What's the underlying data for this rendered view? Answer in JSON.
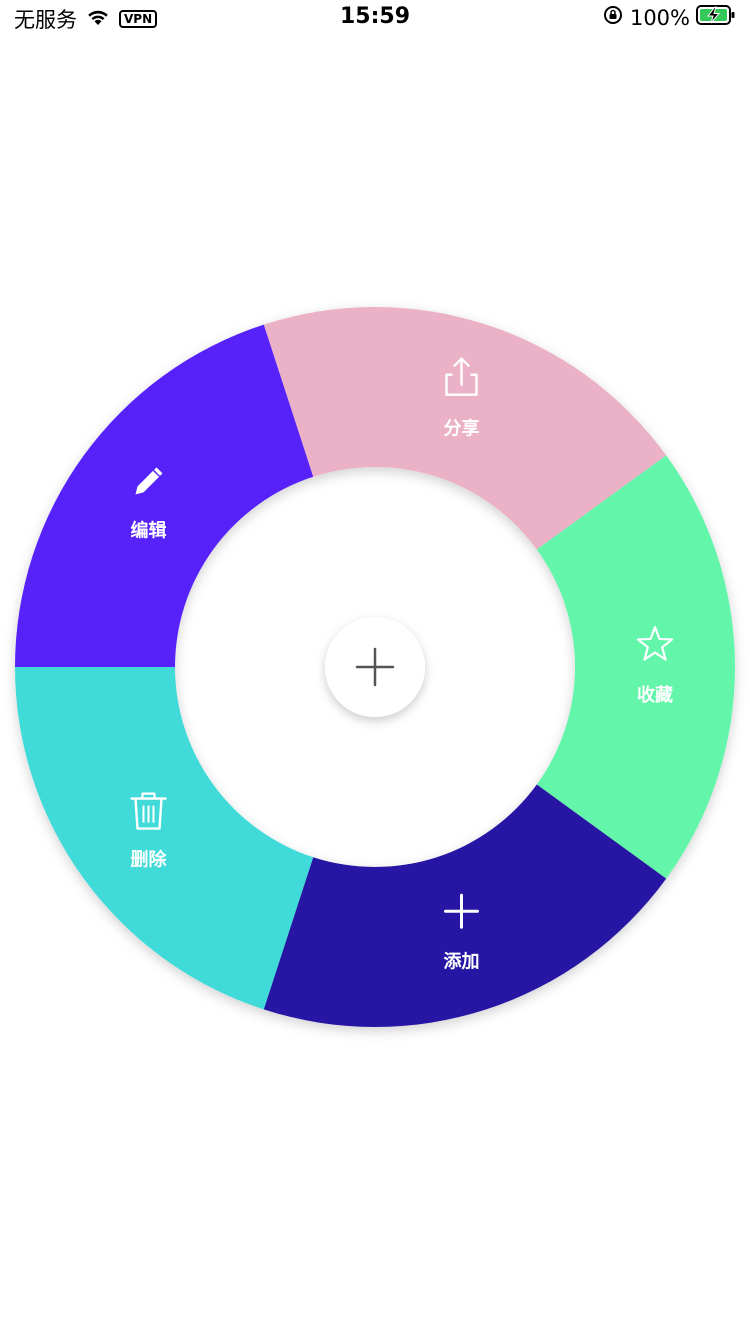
{
  "status_bar": {
    "carrier": "无服务",
    "vpn": "VPN",
    "time": "15:59",
    "battery_percent": "100%"
  },
  "center_button": {
    "icon": "plus-icon"
  },
  "menu": {
    "items": [
      {
        "id": "share",
        "label": "分享",
        "icon": "share-icon",
        "color": "#EBB1C7"
      },
      {
        "id": "favorite",
        "label": "收藏",
        "icon": "star-icon",
        "color": "#64F6AA"
      },
      {
        "id": "add",
        "label": "添加",
        "icon": "plus-icon",
        "color": "#2715A3"
      },
      {
        "id": "delete",
        "label": "删除",
        "icon": "trash-icon",
        "color": "#3FDBD9"
      },
      {
        "id": "edit",
        "label": "编辑",
        "icon": "pencil-icon",
        "color": "#5723F9"
      }
    ]
  }
}
